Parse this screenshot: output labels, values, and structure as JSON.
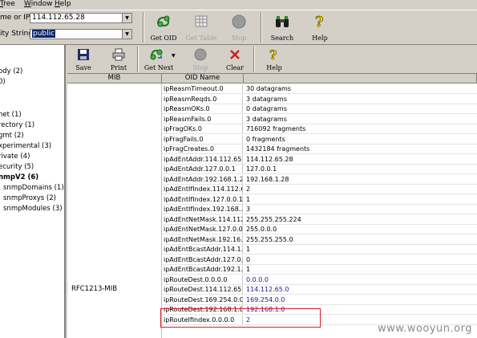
{
  "menu": [
    "Tree",
    "Window",
    "Help"
  ],
  "query": {
    "host_label": "me or IP",
    "host_value": "114.112.65.28",
    "community_label": "ity String",
    "community_value": "public"
  },
  "top_toolbar": [
    {
      "label": "Get OID",
      "icon": "get-oid-icon",
      "enabled": true
    },
    {
      "label": "Get Table",
      "icon": "table-icon",
      "enabled": false
    },
    {
      "label": "Stop",
      "icon": "stop-icon",
      "enabled": false
    },
    {
      "label": "Search",
      "icon": "binoculars-icon",
      "enabled": true
    },
    {
      "label": "Help",
      "icon": "help-icon",
      "enabled": true
    }
  ],
  "tree": [
    "ody (2)",
    "0)",
    "net (1)",
    "rectory (1)",
    "gmt (2)",
    "xperimental (3)",
    "rivate (4)",
    "ecurity (5)",
    "nmpV2 (6)",
    "snmpDomains (1)",
    "snmpProxys (2)",
    "snmpModules (3)"
  ],
  "right_toolbar": [
    {
      "label": "Save",
      "icon": "save-icon",
      "enabled": true
    },
    {
      "label": "Print",
      "icon": "print-icon",
      "enabled": true
    },
    {
      "label": "Get Next",
      "icon": "get-next-icon",
      "enabled": true
    },
    {
      "label": "Stop",
      "icon": "stop-icon",
      "enabled": false
    },
    {
      "label": "Clear",
      "icon": "clear-icon",
      "enabled": true
    },
    {
      "label": "Help",
      "icon": "help-icon",
      "enabled": true
    }
  ],
  "table": {
    "headers": [
      "MIB",
      "OID Name"
    ],
    "mib_label": "RFC1213-MIB",
    "rows": [
      [
        "ipReasmTimeout.0",
        "30 datagrams"
      ],
      [
        "ipReasmReqds.0",
        "3 datagrams"
      ],
      [
        "ipReasmOKs.0",
        "0 datagrams"
      ],
      [
        "ipReasmFails.0",
        "3 datagrams"
      ],
      [
        "ipFragOKs.0",
        "716092 fragments"
      ],
      [
        "ipFragFails.0",
        "0 fragments"
      ],
      [
        "ipFragCreates.0",
        "1432184 fragments"
      ],
      [
        "ipAdEntAddr.114.112.65...",
        "114.112.65.28"
      ],
      [
        "ipAdEntAddr.127.0.0.1",
        "127.0.0.1"
      ],
      [
        "ipAdEntAddr.192.168.1.28",
        "192.168.1.28"
      ],
      [
        "ipAdEntIfIndex.114.112.6...",
        "2"
      ],
      [
        "ipAdEntIfIndex.127.0.0.1",
        "1"
      ],
      [
        "ipAdEntIfIndex.192.168....",
        "3"
      ],
      [
        "ipAdEntNetMask.114.112...",
        "255.255.255.224"
      ],
      [
        "ipAdEntNetMask.127.0.0.1",
        "255.0.0.0"
      ],
      [
        "ipAdEntNetMask.192.16...",
        "255.255.255.0"
      ],
      [
        "ipAdEntBcastAddr.114.1...",
        "1"
      ],
      [
        "ipAdEntBcastAddr.127.0...",
        "0"
      ],
      [
        "ipAdEntBcastAddr.192.1...",
        "1"
      ],
      [
        "ipRouteDest.0.0.0.0",
        "0.0.0.0"
      ],
      [
        "ipRouteDest.114.112.65.0",
        "114.112.65.0"
      ],
      [
        "ipRouteDest.169.254.0.0",
        "169.254.0.0"
      ],
      [
        "ipRouteDest.192.168.1.0",
        "192.168.1.0"
      ],
      [
        "ipRouteIfIndex.0.0.0.0",
        "2"
      ]
    ]
  },
  "watermark": "www.wooyun.org",
  "colors": {
    "highlight_box": "#d81e2a",
    "route_value": "#1a1a9c",
    "selection": "#0a246a"
  }
}
